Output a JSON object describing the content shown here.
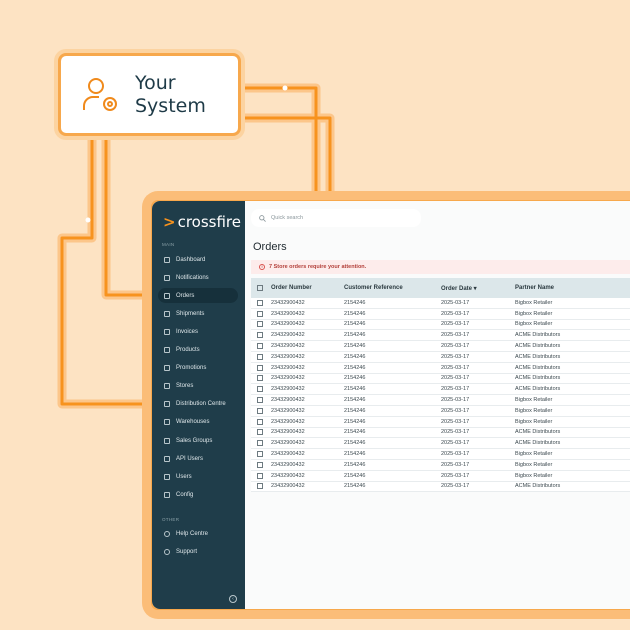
{
  "system_box": {
    "title_line1": "Your",
    "title_line2": "System",
    "icon": "user-gear-icon"
  },
  "colors": {
    "accent": "#f7931e",
    "sidebar": "#1f3d4a",
    "background": "#fde3c3"
  },
  "app": {
    "logo": "crossfire",
    "search": {
      "placeholder": "Quick search"
    },
    "sidebar": {
      "section_main": "MAIN",
      "items": [
        {
          "label": "Dashboard"
        },
        {
          "label": "Notifications"
        },
        {
          "label": "Orders"
        },
        {
          "label": "Shipments"
        },
        {
          "label": "Invoices"
        },
        {
          "label": "Products"
        },
        {
          "label": "Promotions"
        },
        {
          "label": "Stores"
        },
        {
          "label": "Distribution Centre"
        },
        {
          "label": "Warehouses"
        },
        {
          "label": "Sales Groups"
        },
        {
          "label": "API Users"
        },
        {
          "label": "Users"
        },
        {
          "label": "Config"
        }
      ],
      "section_other": "OTHER",
      "other_items": [
        {
          "label": "Help Centre"
        },
        {
          "label": "Support"
        }
      ]
    },
    "page_title": "Orders",
    "alert": "7 Store orders require your attention.",
    "table": {
      "columns": [
        "Order Number",
        "Customer Reference",
        "Order Date ▾",
        "Partner Name"
      ],
      "rows": [
        [
          "23432900432",
          "2154246",
          "2025-03-17",
          "Bigbox Retailer"
        ],
        [
          "23432900432",
          "2154246",
          "2025-03-17",
          "Bigbox Retailer"
        ],
        [
          "23432900432",
          "2154246",
          "2025-03-17",
          "Bigbox Retailer"
        ],
        [
          "23432900432",
          "2154246",
          "2025-03-17",
          "ACME Distributors"
        ],
        [
          "23432900432",
          "2154246",
          "2025-03-17",
          "ACME Distributors"
        ],
        [
          "23432900432",
          "2154246",
          "2025-03-17",
          "ACME Distributors"
        ],
        [
          "23432900432",
          "2154246",
          "2025-03-17",
          "ACME Distributors"
        ],
        [
          "23432900432",
          "2154246",
          "2025-03-17",
          "ACME Distributors"
        ],
        [
          "23432900432",
          "2154246",
          "2025-03-17",
          "ACME Distributors"
        ],
        [
          "23432900432",
          "2154246",
          "2025-03-17",
          "Bigbox Retailer"
        ],
        [
          "23432900432",
          "2154246",
          "2025-03-17",
          "Bigbox Retailer"
        ],
        [
          "23432900432",
          "2154246",
          "2025-03-17",
          "Bigbox Retailer"
        ],
        [
          "23432900432",
          "2154246",
          "2025-03-17",
          "ACME Distributors"
        ],
        [
          "23432900432",
          "2154246",
          "2025-03-17",
          "ACME Distributors"
        ],
        [
          "23432900432",
          "2154246",
          "2025-03-17",
          "Bigbox Retailer"
        ],
        [
          "23432900432",
          "2154246",
          "2025-03-17",
          "Bigbox Retailer"
        ],
        [
          "23432900432",
          "2154246",
          "2025-03-17",
          "Bigbox Retailer"
        ],
        [
          "23432900432",
          "2154246",
          "2025-03-17",
          "ACME Distributors"
        ]
      ]
    }
  }
}
